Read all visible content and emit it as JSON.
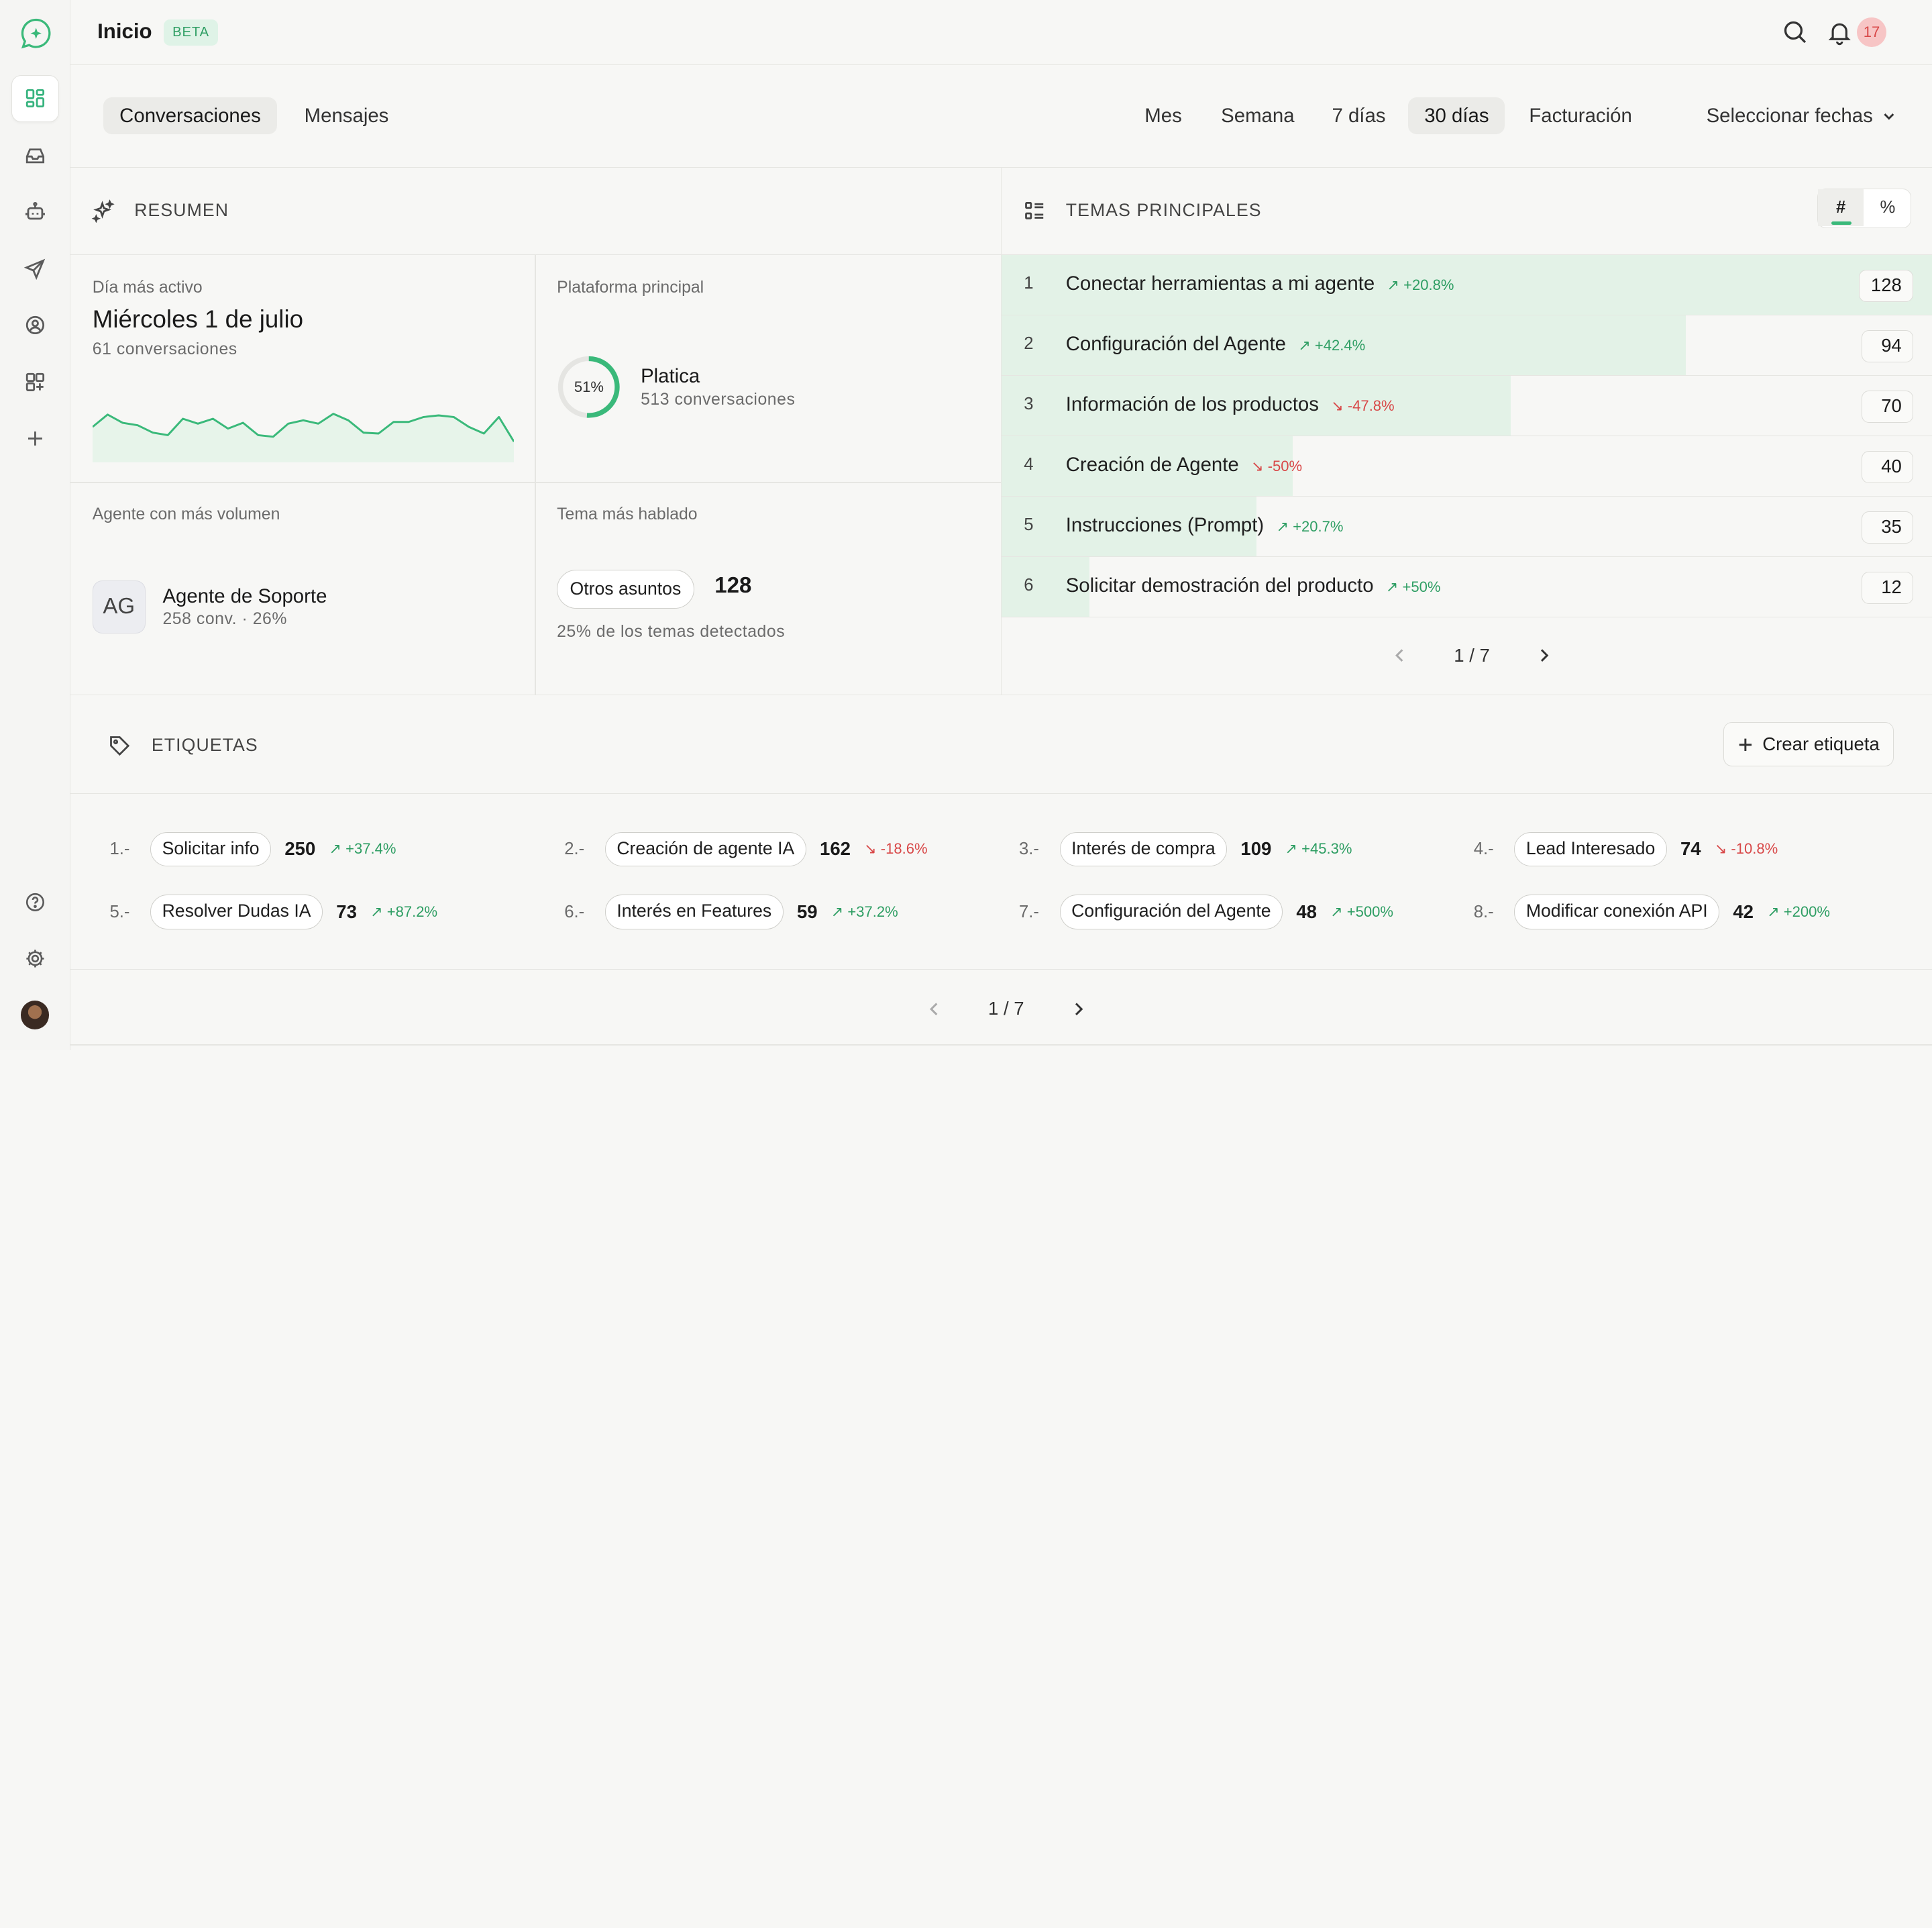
{
  "header": {
    "title": "Inicio",
    "badge": "BETA",
    "notifications": "17"
  },
  "view_tabs": [
    {
      "label": "Conversaciones",
      "active": true
    },
    {
      "label": "Mensajes",
      "active": false
    }
  ],
  "ranges": [
    {
      "label": "Mes",
      "active": false
    },
    {
      "label": "Semana",
      "active": false
    },
    {
      "label": "7 días",
      "active": false
    },
    {
      "label": "30 días",
      "active": true
    },
    {
      "label": "Facturación",
      "active": false
    }
  ],
  "date_select": "Seleccionar fechas",
  "resumen": {
    "title": "RESUMEN",
    "most_active_day": {
      "label": "Día más activo",
      "value": "Miércoles 1 de julio",
      "sub": "61 conversaciones",
      "sparkline": [
        40,
        55,
        45,
        42,
        33,
        30,
        50,
        44,
        50,
        38,
        45,
        30,
        28,
        44,
        48,
        44,
        56,
        48,
        33,
        32,
        46,
        46,
        52,
        54,
        52,
        40,
        32,
        52,
        22
      ]
    },
    "main_platform": {
      "label": "Plataforma principal",
      "percent_text": "51%",
      "percent": 51,
      "name": "Platica",
      "sub": "513 conversaciones"
    },
    "top_agent": {
      "label": "Agente con más volumen",
      "initials": "AG",
      "name": "Agente de Soporte",
      "sub": "258 conv. · 26%"
    },
    "top_theme": {
      "label": "Tema más hablado",
      "chip": "Otros asuntos",
      "count": "128",
      "sub": "25% de los temas detectados"
    }
  },
  "temas": {
    "title": "TEMAS PRINCIPALES",
    "toggle": [
      "#",
      "%"
    ],
    "rows": [
      {
        "rank": "1",
        "name": "Conectar herramientas a mi agente",
        "trend": "↗ +20.8%",
        "dir": "up",
        "count": "128",
        "value": 128
      },
      {
        "rank": "2",
        "name": "Configuración del Agente",
        "trend": "↗ +42.4%",
        "dir": "up",
        "count": "94",
        "value": 94
      },
      {
        "rank": "3",
        "name": "Información de los productos",
        "trend": "↘ -47.8%",
        "dir": "down",
        "count": "70",
        "value": 70
      },
      {
        "rank": "4",
        "name": "Creación de Agente",
        "trend": "↘ -50%",
        "dir": "down",
        "count": "40",
        "value": 40
      },
      {
        "rank": "5",
        "name": "Instrucciones (Prompt)",
        "trend": "↗ +20.7%",
        "dir": "up",
        "count": "35",
        "value": 35
      },
      {
        "rank": "6",
        "name": "Solicitar demostración del producto",
        "trend": "↗ +50%",
        "dir": "up",
        "count": "12",
        "value": 12
      }
    ],
    "max_value": 128,
    "pager": "1 / 7"
  },
  "etiquetas": {
    "title": "ETIQUETAS",
    "create_label": "Crear etiqueta",
    "items": [
      {
        "rank": "1.-",
        "name": "Solicitar info",
        "count": "250",
        "trend": "↗ +37.4%",
        "dir": "up"
      },
      {
        "rank": "2.-",
        "name": "Creación de agente IA",
        "count": "162",
        "trend": "↘ -18.6%",
        "dir": "down"
      },
      {
        "rank": "3.-",
        "name": "Interés de compra",
        "count": "109",
        "trend": "↗ +45.3%",
        "dir": "up"
      },
      {
        "rank": "4.-",
        "name": "Lead Interesado",
        "count": "74",
        "trend": "↘ -10.8%",
        "dir": "down"
      },
      {
        "rank": "5.-",
        "name": "Resolver Dudas IA",
        "count": "73",
        "trend": "↗ +87.2%",
        "dir": "up"
      },
      {
        "rank": "6.-",
        "name": "Interés en Features",
        "count": "59",
        "trend": "↗ +37.2%",
        "dir": "up"
      },
      {
        "rank": "7.-",
        "name": "Configuración del Agente",
        "count": "48",
        "trend": "↗ +500%",
        "dir": "up"
      },
      {
        "rank": "8.-",
        "name": "Modificar conexión API",
        "count": "42",
        "trend": "↗ +200%",
        "dir": "up"
      }
    ],
    "pager": "1 / 7"
  },
  "colors": {
    "accent": "#3ab97a",
    "bar": "#e3f2e7",
    "up": "#2e9e63",
    "down": "#d84848"
  }
}
